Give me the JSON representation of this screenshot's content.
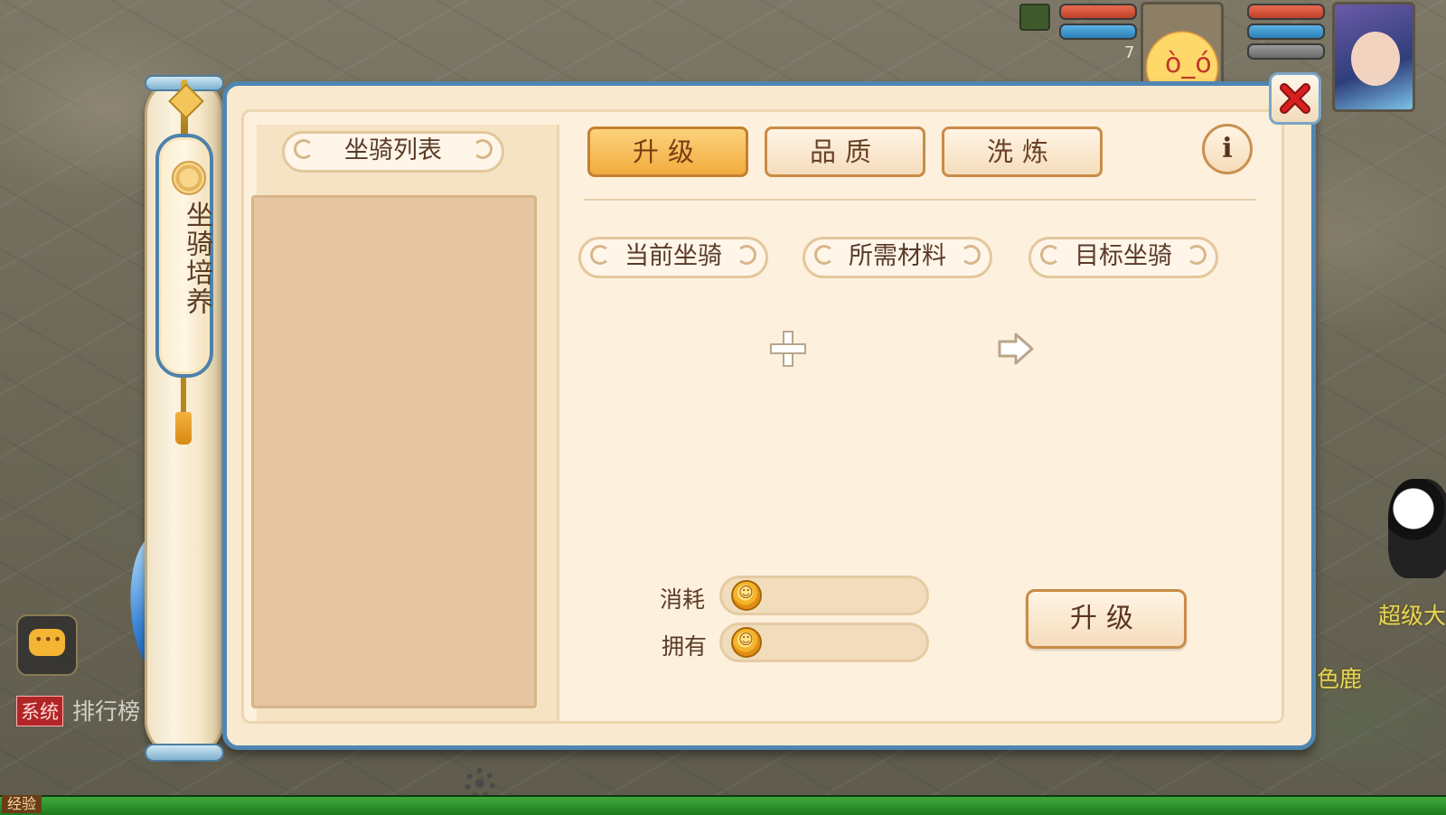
{
  "hud": {
    "pet_level": "7",
    "chat_icon": "chat-bubble-icon",
    "system_tag": "系统",
    "system_message": "排行榜",
    "exp_label": "经验",
    "side_texts": [
      "超级大",
      "色鹿"
    ]
  },
  "sidebar": {
    "title": "坐骑培养"
  },
  "panel": {
    "list_header": "坐骑列表",
    "tabs": [
      {
        "label": "升级",
        "active": true
      },
      {
        "label": "品质",
        "active": false
      },
      {
        "label": "洗炼",
        "active": false
      }
    ],
    "info_label": "i",
    "sections": {
      "current": "当前坐骑",
      "materials": "所需材料",
      "target": "目标坐骑"
    },
    "cost": {
      "consume_label": "消耗",
      "consume_value": "",
      "own_label": "拥有",
      "own_value": ""
    },
    "upgrade_button": "升级"
  },
  "colors": {
    "panel_border": "#4f86b3",
    "tab_active": "#f2ab3d",
    "close_x": "#d62020"
  }
}
